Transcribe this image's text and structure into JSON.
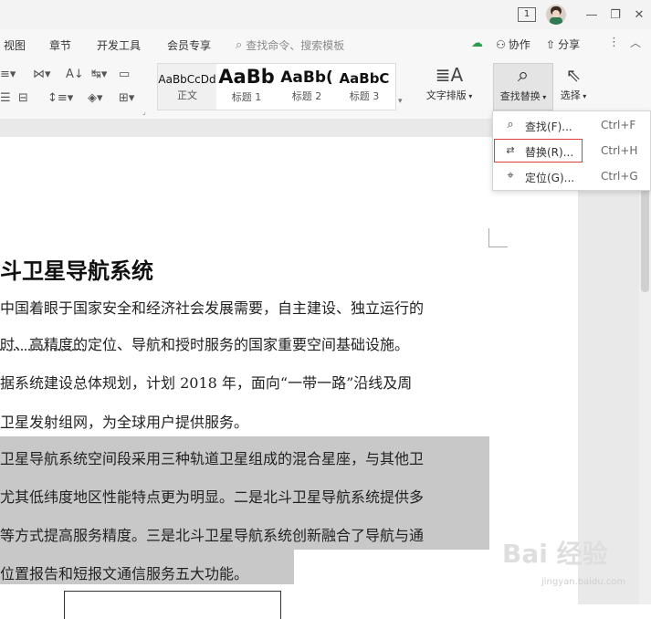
{
  "titlebar": {
    "page_indicator": "1"
  },
  "menu_tabs": [
    "视图",
    "章节",
    "开发工具",
    "会员专享"
  ],
  "search_cmd_placeholder": "查找命令、搜索模板",
  "right_actions": {
    "collab": "协作",
    "share": "分享"
  },
  "styles": [
    {
      "preview": "AaBbCcDd",
      "name": "正文"
    },
    {
      "preview": "AaBb",
      "name": "标题 1"
    },
    {
      "preview": "AaBb(",
      "name": "标题 2"
    },
    {
      "preview": "AaBbC",
      "name": "标题 3"
    }
  ],
  "ribbon_buttons": {
    "text_layout": "文字排版",
    "find_replace": "查找替换",
    "select": "选择"
  },
  "dropdown": [
    {
      "label": "查找(F)...",
      "shortcut": "Ctrl+F"
    },
    {
      "label": "替换(R)...",
      "shortcut": "Ctrl+H"
    },
    {
      "label": "定位(G)...",
      "shortcut": "Ctrl+G"
    }
  ],
  "document": {
    "title": "斗卫星导航系统",
    "lines": [
      "中国着眼于国家安全和经济社会发展需要，自主建设、独立运行的",
      "时、高精度的定位、导航和授时服务的国家重要空间基础设施。",
      "据系统建设总体规划，计划 2018 年，面向“一带一路”沿线及周",
      "卫星发射组网，为全球用户提供服务。",
      "卫星导航系统空间段采用三种轨道卫星组成的混合星座，与其他卫",
      "尤其低纬度地区性能特点更为明显。二是北斗卫星导航系统提供多",
      "等方式提高服务精度。三是北斗卫星导航系统创新融合了导航与通",
      "位置报告和短报文通信服务五大功能。"
    ]
  },
  "watermark": {
    "text": "Bai 经验",
    "sub": "jingyan.baidu.com"
  }
}
